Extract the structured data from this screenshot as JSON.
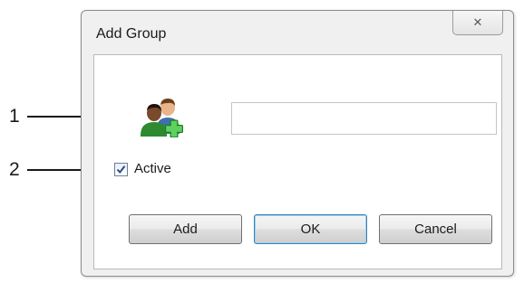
{
  "callouts": [
    {
      "number": "1"
    },
    {
      "number": "2"
    }
  ],
  "dialog": {
    "title": "Add Group",
    "close_symbol": "✕",
    "icon": "add-group-icon",
    "name_value": "",
    "active_label": "Active",
    "active_checked": true,
    "buttons": {
      "add": "Add",
      "ok": "OK",
      "cancel": "Cancel"
    }
  },
  "colors": {
    "default_button_border": "#3c7fb1",
    "checkmark": "#2a4a8a",
    "group_icon_green": "#2e9b2e"
  }
}
